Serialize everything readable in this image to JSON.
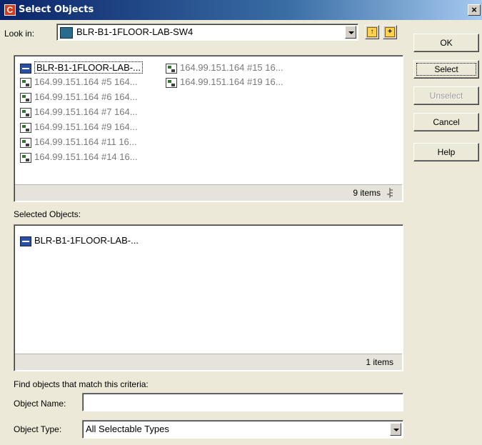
{
  "window": {
    "title": "Select Objects",
    "title_icon_letter": "C",
    "close_glyph": "×"
  },
  "look_in": {
    "label": "Look in:",
    "value": "BLR-B1-1FLOOR-LAB-SW4"
  },
  "objects": {
    "items": [
      {
        "label": "BLR-B1-1FLOOR-LAB-...",
        "icon": "switch-icon",
        "state": "selected"
      },
      {
        "label": "164.99.151.164 #5 164...",
        "icon": "port-icon",
        "state": "dim"
      },
      {
        "label": "164.99.151.164 #6 164...",
        "icon": "port-icon",
        "state": "dim"
      },
      {
        "label": "164.99.151.164 #7 164...",
        "icon": "port-icon",
        "state": "dim"
      },
      {
        "label": "164.99.151.164 #9 164...",
        "icon": "port-icon",
        "state": "dim"
      },
      {
        "label": "164.99.151.164 #11 16...",
        "icon": "port-icon",
        "state": "dim"
      },
      {
        "label": "164.99.151.164 #14 16...",
        "icon": "port-icon",
        "state": "dim"
      },
      {
        "label": "164.99.151.164 #15 16...",
        "icon": "port-icon",
        "state": "dim"
      },
      {
        "label": "164.99.151.164 #19 16...",
        "icon": "port-icon",
        "state": "dim"
      }
    ],
    "count": "9 items"
  },
  "selected_objects": {
    "label": "Selected Objects:",
    "items": [
      {
        "label": "BLR-B1-1FLOOR-LAB-...",
        "icon": "switch-icon"
      }
    ],
    "count": "1 items"
  },
  "criteria": {
    "heading": "Find objects that match this criteria:",
    "name_label": "Object Name:",
    "name_value": "",
    "type_label": "Object Type:",
    "type_value": "All Selectable Types"
  },
  "buttons": {
    "ok": "OK",
    "select": "Select",
    "unselect": "Unselect",
    "cancel": "Cancel",
    "help": "Help"
  }
}
